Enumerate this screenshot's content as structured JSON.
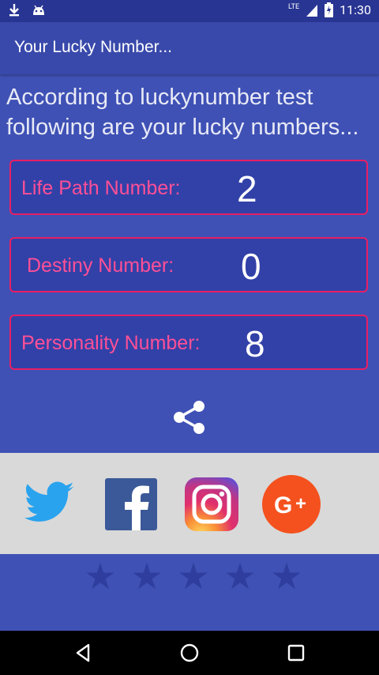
{
  "status_bar": {
    "time": "11:30",
    "network": "LTE"
  },
  "app_bar": {
    "title": "Your Lucky Number..."
  },
  "intro_text": "According to luckynumber test following are your lucky numbers...",
  "numbers": [
    {
      "label": "Life Path Number:",
      "value": "2"
    },
    {
      "label": "Destiny Number:",
      "value": "0"
    },
    {
      "label": "Personality Number:",
      "value": "8"
    }
  ],
  "icons": {
    "share": "share-icon",
    "twitter": "twitter-icon",
    "facebook": "facebook-icon",
    "instagram": "instagram-icon",
    "google_plus": "google-plus-icon"
  },
  "colors": {
    "background": "#3f51b5",
    "app_bar": "#3949ab",
    "status_bar": "#283593",
    "card_border": "#e91e63",
    "label": "#ff4f96",
    "social_strip": "#d9d9d9",
    "star": "#2f3e9e"
  },
  "rating": {
    "stars_total": 5,
    "stars_filled": 0
  }
}
